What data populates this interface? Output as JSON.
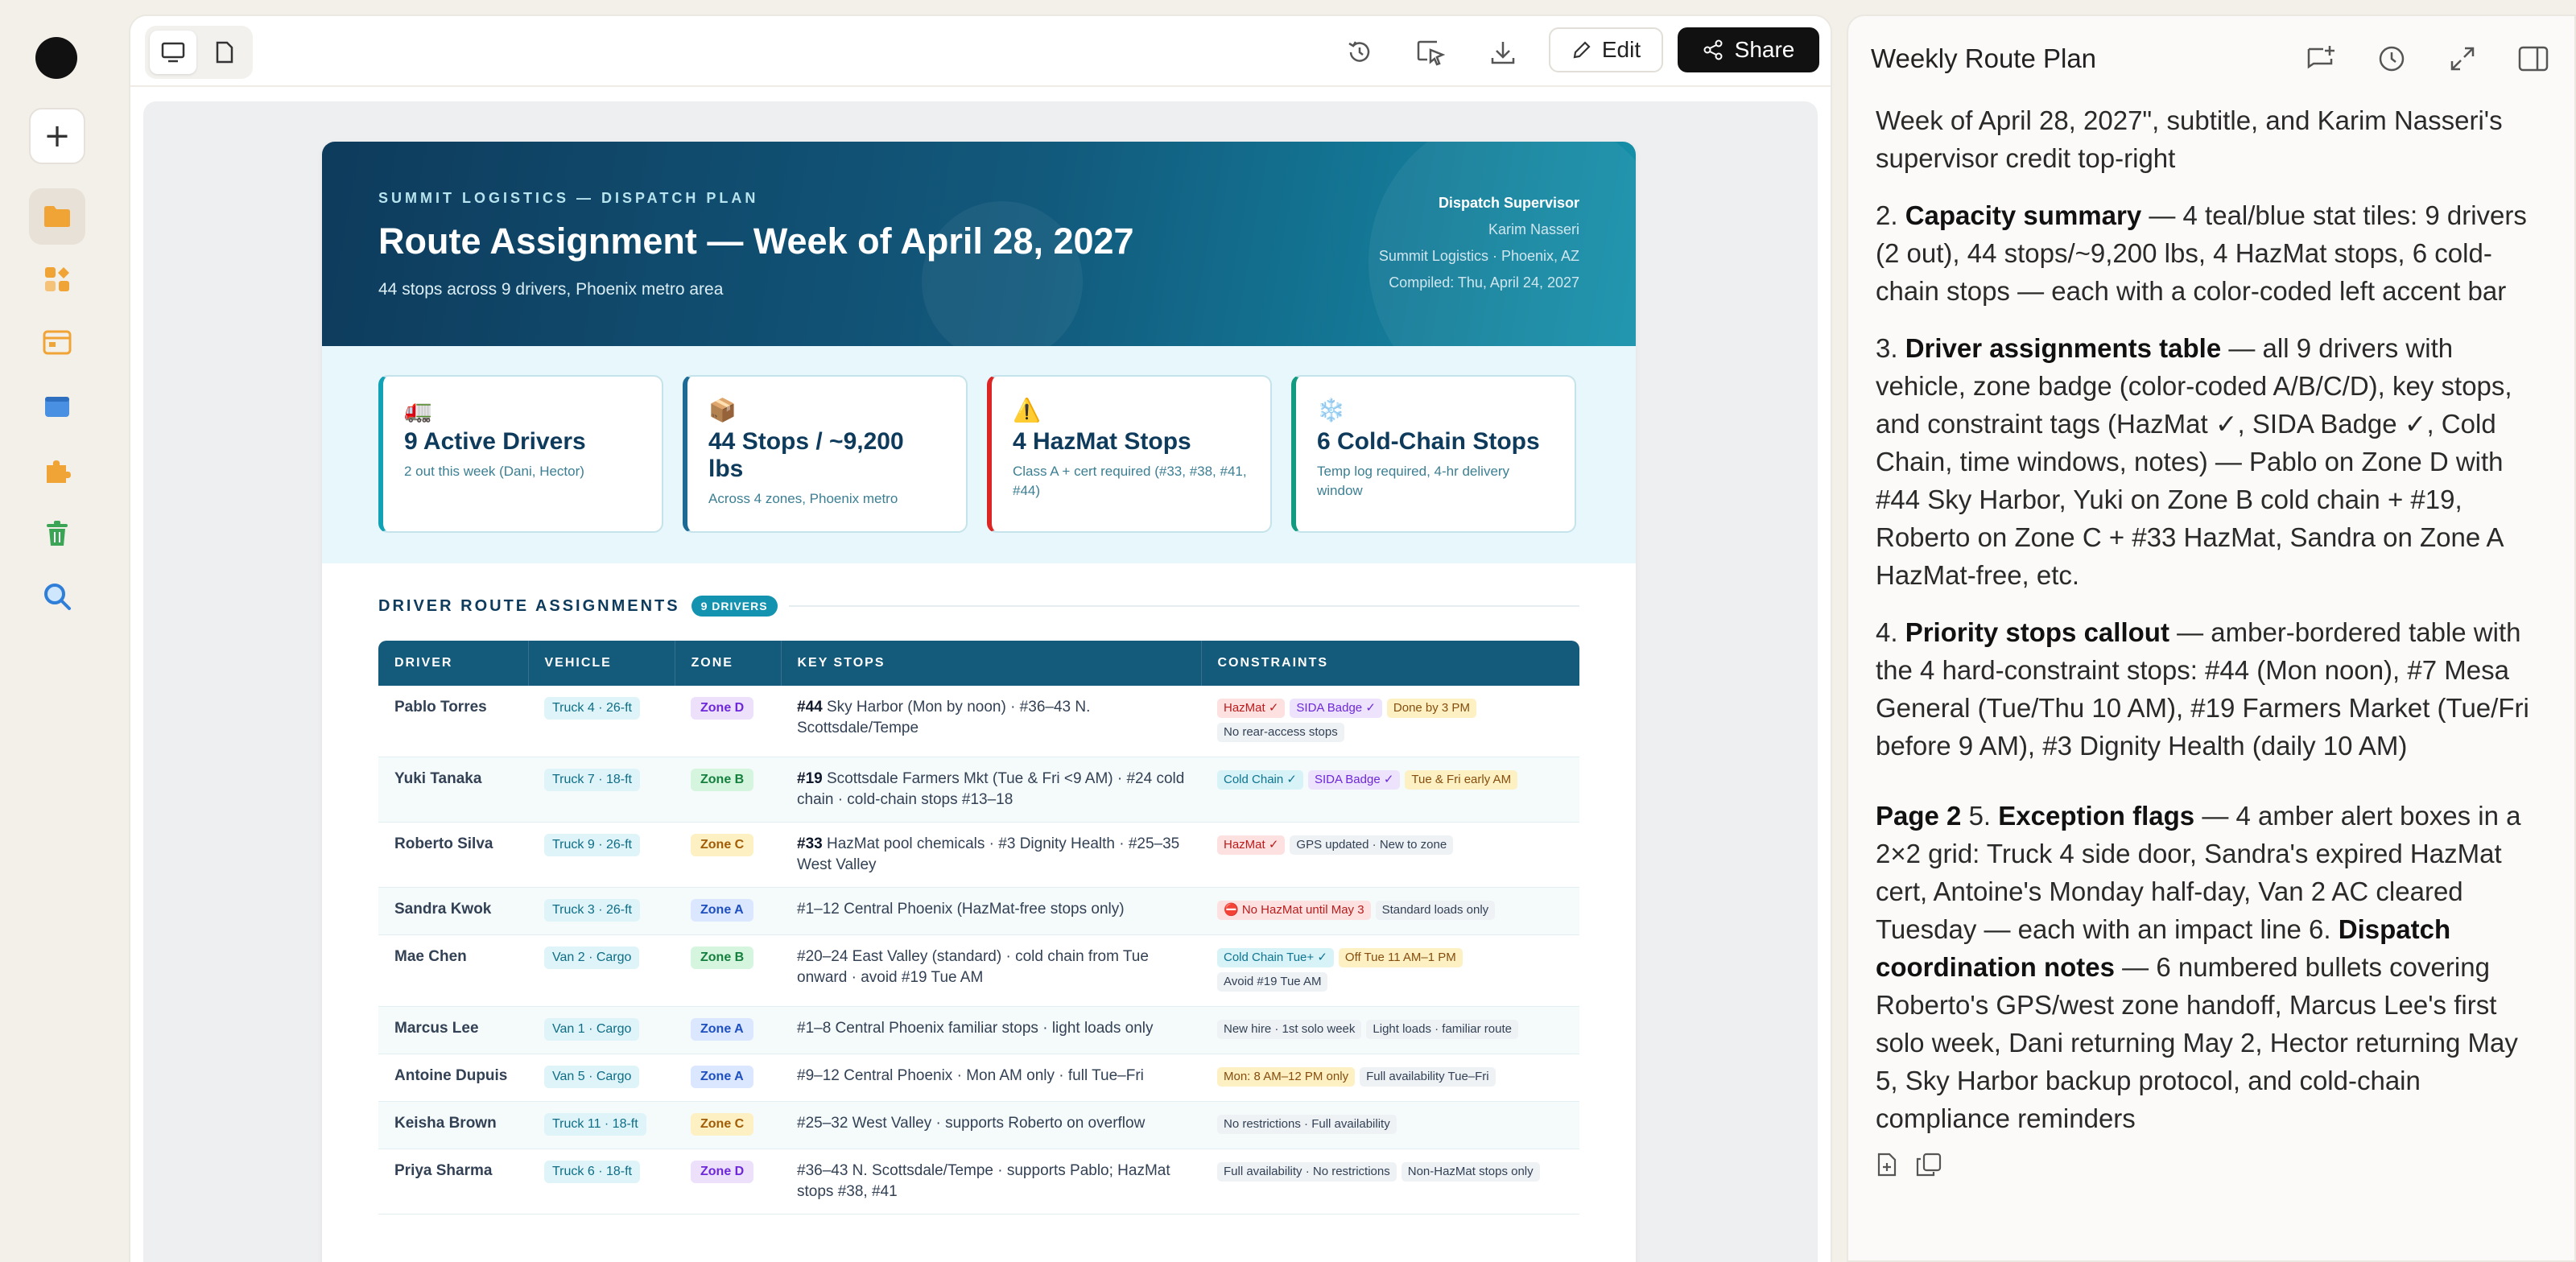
{
  "toolbar": {
    "edit_label": "Edit",
    "share_label": "Share"
  },
  "doc": {
    "kicker": "SUMMIT LOGISTICS — DISPATCH PLAN",
    "title": "Route Assignment — Week of April 28, 2027",
    "subtitle": "44 stops across 9 drivers, Phoenix metro area",
    "meta": {
      "role": "Dispatch Supervisor",
      "name": "Karim Nasseri",
      "org": "Summit Logistics · Phoenix, AZ",
      "compiled": "Compiled: Thu, April 24, 2027"
    },
    "stats": [
      {
        "icon": "🚛",
        "title": "9 Active Drivers",
        "desc": "2 out this week (Dani, Hector)"
      },
      {
        "icon": "📦",
        "title": "44 Stops / ~9,200 lbs",
        "desc": "Across 4 zones, Phoenix metro"
      },
      {
        "icon": "⚠️",
        "title": "4 HazMat Stops",
        "desc": "Class A + cert required (#33, #38, #41, #44)"
      },
      {
        "icon": "❄️",
        "title": "6 Cold-Chain Stops",
        "desc": "Temp log required, 4-hr delivery window"
      }
    ],
    "section_title": "DRIVER ROUTE ASSIGNMENTS",
    "section_badge": "9 DRIVERS",
    "table_headers": [
      "DRIVER",
      "VEHICLE",
      "ZONE",
      "KEY STOPS",
      "CONSTRAINTS"
    ],
    "rows": [
      {
        "driver": "Pablo Torres",
        "vehicle": "Truck 4 · 26-ft",
        "zone": "Zone D",
        "zone_class": "zd",
        "stops_lead": "#44",
        "stops": " Sky Harbor (Mon by noon) · #36–43 N. Scottsdale/Tempe",
        "tags": [
          [
            "HazMat ✓",
            "t-haz"
          ],
          [
            "SIDA Badge ✓",
            "t-sida"
          ],
          [
            "Done by 3 PM",
            "t-amb"
          ],
          [
            "No rear-access stops",
            ""
          ]
        ]
      },
      {
        "driver": "Yuki Tanaka",
        "vehicle": "Truck 7 · 18-ft",
        "zone": "Zone B",
        "zone_class": "zb",
        "stops_lead": "#19",
        "stops": " Scottsdale Farmers Mkt (Tue & Fri <9 AM) · #24 cold chain · cold-chain stops #13–18",
        "tags": [
          [
            "Cold Chain ✓",
            "t-cold"
          ],
          [
            "SIDA Badge ✓",
            "t-sida"
          ],
          [
            "Tue & Fri early AM",
            "t-amb"
          ]
        ]
      },
      {
        "driver": "Roberto Silva",
        "vehicle": "Truck 9 · 26-ft",
        "zone": "Zone C",
        "zone_class": "zc",
        "stops_lead": "#33",
        "stops": " HazMat pool chemicals · #3 Dignity Health · #25–35 West Valley",
        "tags": [
          [
            "HazMat ✓",
            "t-haz"
          ],
          [
            "GPS updated · New to zone",
            ""
          ]
        ]
      },
      {
        "driver": "Sandra Kwok",
        "vehicle": "Truck 3 · 26-ft",
        "zone": "Zone A",
        "zone_class": "za",
        "stops_lead": "",
        "stops": "#1–12 Central Phoenix (HazMat-free stops only)",
        "tags": [
          [
            "⛔ No HazMat until May 3",
            "t-haz"
          ],
          [
            "Standard loads only",
            ""
          ]
        ]
      },
      {
        "driver": "Mae Chen",
        "vehicle": "Van 2 · Cargo",
        "zone": "Zone B",
        "zone_class": "zb",
        "stops_lead": "",
        "stops": "#20–24 East Valley (standard) · cold chain from Tue onward · avoid #19 Tue AM",
        "tags": [
          [
            "Cold Chain Tue+ ✓",
            "t-cold"
          ],
          [
            "Off Tue 11 AM–1 PM",
            "t-amb"
          ],
          [
            "Avoid #19 Tue AM",
            ""
          ]
        ]
      },
      {
        "driver": "Marcus Lee",
        "vehicle": "Van 1 · Cargo",
        "zone": "Zone A",
        "zone_class": "za",
        "stops_lead": "",
        "stops": "#1–8 Central Phoenix familiar stops · light loads only",
        "tags": [
          [
            "New hire · 1st solo week",
            ""
          ],
          [
            "Light loads · familiar route",
            ""
          ]
        ]
      },
      {
        "driver": "Antoine Dupuis",
        "vehicle": "Van 5 · Cargo",
        "zone": "Zone A",
        "zone_class": "za",
        "stops_lead": "",
        "stops": "#9–12 Central Phoenix · Mon AM only · full Tue–Fri",
        "tags": [
          [
            "Mon: 8 AM–12 PM only",
            "t-amb"
          ],
          [
            "Full availability Tue–Fri",
            ""
          ]
        ]
      },
      {
        "driver": "Keisha Brown",
        "vehicle": "Truck 11 · 18-ft",
        "zone": "Zone C",
        "zone_class": "zc",
        "stops_lead": "",
        "stops": "#25–32 West Valley · supports Roberto on overflow",
        "tags": [
          [
            "No restrictions · Full availability",
            ""
          ]
        ]
      },
      {
        "driver": "Priya Sharma",
        "vehicle": "Truck 6 · 18-ft",
        "zone": "Zone D",
        "zone_class": "zd",
        "stops_lead": "",
        "stops": "#36–43 N. Scottsdale/Tempe · supports Pablo; HazMat stops #38, #41",
        "tags": [
          [
            "Full availability · No restrictions",
            ""
          ],
          [
            "Non-HazMat stops only",
            ""
          ]
        ]
      }
    ]
  },
  "side": {
    "title": "Weekly Route Plan",
    "paragraphs": [
      {
        "lead": "",
        "bold": "",
        "text": "Week of April 28, 2027\", subtitle, and Karim Nasseri's supervisor credit top-right"
      },
      {
        "lead": "2. ",
        "bold": "Capacity summary",
        "text": " — 4 teal/blue stat tiles: 9 drivers (2 out), 44 stops/~9,200 lbs, 4 HazMat stops, 6 cold-chain stops — each with a color-coded left accent bar"
      },
      {
        "lead": "3. ",
        "bold": "Driver assignments table",
        "text": " — all 9 drivers with vehicle, zone badge (color-coded A/B/C/D), key stops, and constraint tags (HazMat ✓, SIDA Badge ✓, Cold Chain, time windows, notes) — Pablo on Zone D with #44 Sky Harbor, Yuki on Zone B cold chain + #19, Roberto on Zone C + #33 HazMat, Sandra on Zone A HazMat-free, etc."
      },
      {
        "lead": "4. ",
        "bold": "Priority stops callout",
        "text": " — amber-bordered table with the 4 hard-constraint stops: #44 (Mon noon), #7 Mesa General (Tue/Thu 10 AM), #19 Farmers Market (Tue/Fri before 9 AM), #3 Dignity Health (daily 10 AM)"
      }
    ],
    "page2": {
      "label": "Page 2",
      "p5_lead": " 5. ",
      "p5_bold": "Exception flags",
      "p5_text": " — 4 amber alert boxes in a 2×2 grid: Truck 4 side door, Sandra's expired HazMat cert, Antoine's Monday half-day, Van 2 AC cleared Tuesday — each with an impact line 6. ",
      "p6_bold": "Dispatch coordination notes",
      "p6_text": " — 6 numbered bullets covering Roberto's GPS/west zone handoff, Marcus Lee's first solo week, Dani returning May 2, Hector returning May 5, Sky Harbor backup protocol, and cold-chain compliance reminders"
    }
  }
}
